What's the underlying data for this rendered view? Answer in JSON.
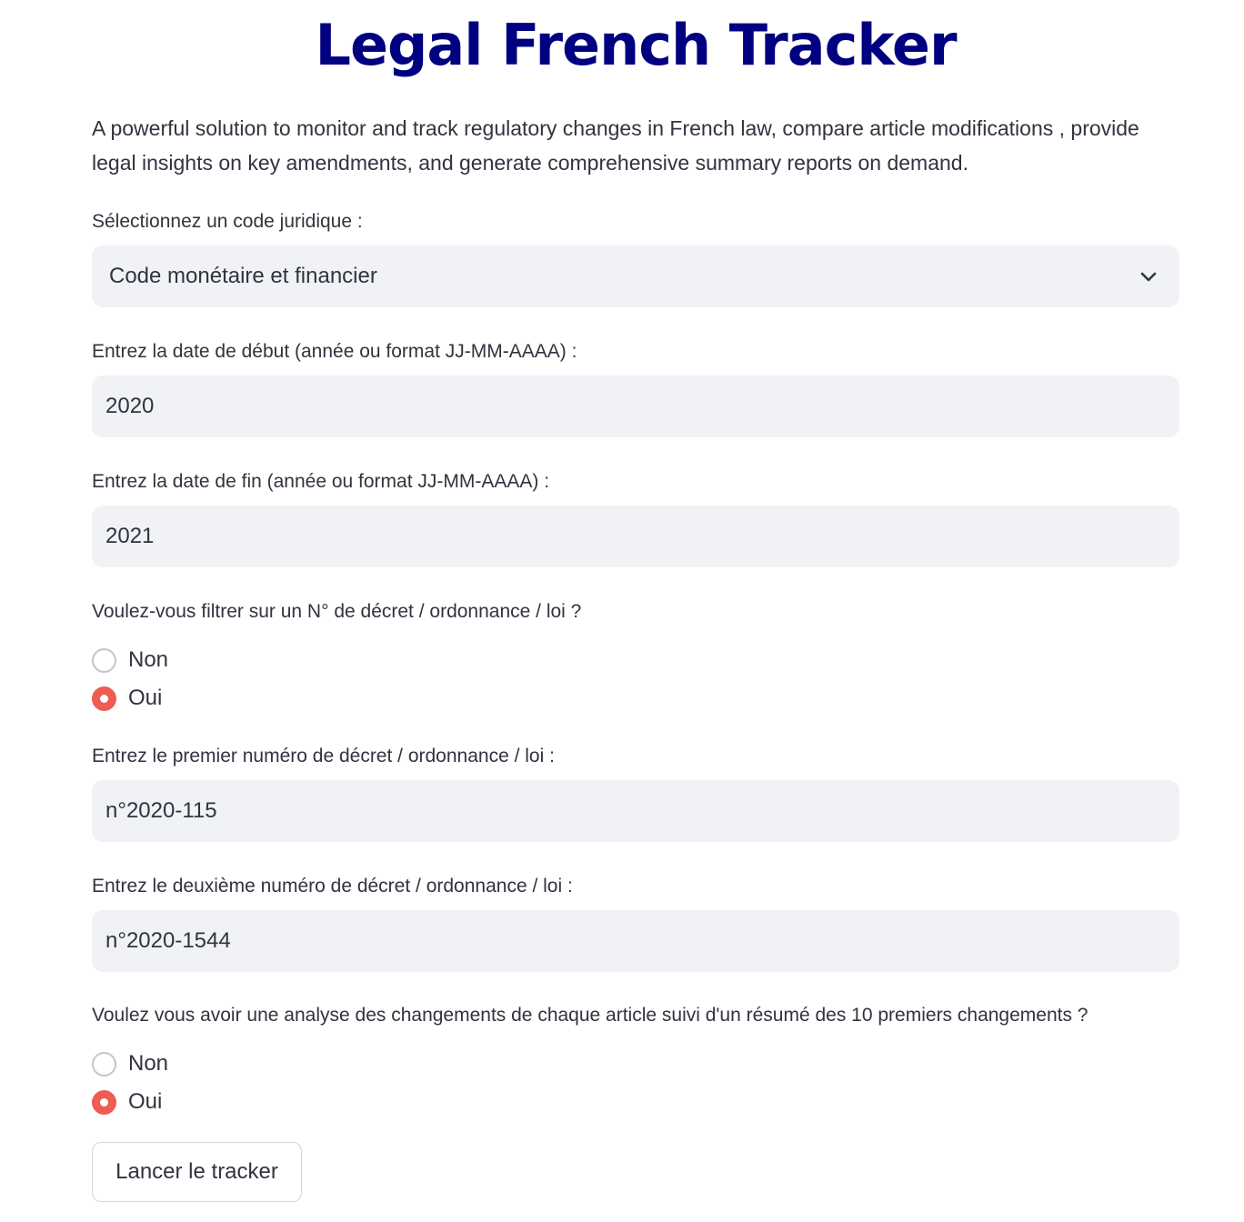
{
  "app": {
    "title": "Legal French Tracker",
    "description": "A powerful solution to monitor and track regulatory changes in French law, compare article modifications , provide legal insights on key amendments, and generate comprehensive summary reports on demand."
  },
  "code_select": {
    "label": "Sélectionnez un code juridique :",
    "selected": "Code monétaire et financier",
    "icon": "chevron-down-icon"
  },
  "start_date": {
    "label": "Entrez la date de début (année ou format JJ-MM-AAAA) :",
    "value": "2020"
  },
  "end_date": {
    "label": "Entrez la date de fin (année ou format JJ-MM-AAAA) :",
    "value": "2021"
  },
  "filter_question": {
    "label": "Voulez-vous filtrer sur un N° de décret / ordonnance / loi ?",
    "options": [
      "Non",
      "Oui"
    ],
    "selected": "Oui"
  },
  "first_number": {
    "label": "Entrez le premier numéro de décret / ordonnance / loi :",
    "value": "n°2020-115"
  },
  "second_number": {
    "label": "Entrez le deuxième numéro de décret / ordonnance / loi :",
    "value": "n°2020-1544"
  },
  "analysis_question": {
    "label": "Voulez vous avoir une analyse des changements de chaque article suivi d'un résumé des 10 premiers changements ?",
    "options": [
      "Non",
      "Oui"
    ],
    "selected": "Oui"
  },
  "submit": {
    "label": "Lancer le tracker"
  },
  "colors": {
    "title": "#000080",
    "accent": "#ee5c54",
    "input_background": "#f0f2f6",
    "text": "#31333f"
  }
}
